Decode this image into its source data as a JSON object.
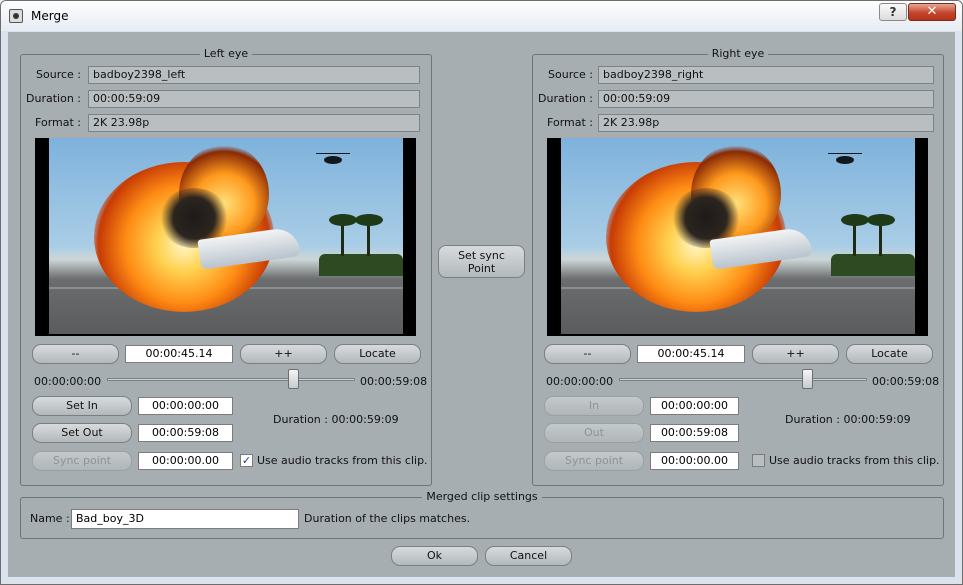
{
  "window": {
    "title": "Merge",
    "help_label": "?",
    "close_label": "✕",
    "icon": "merge-app-icon"
  },
  "left": {
    "title": "Left eye",
    "source_label": "Source :",
    "source": "badboy2398_left",
    "duration_label": "Duration :",
    "duration": "00:00:59:09",
    "format_label": "Format :",
    "format": "2K 23.98p",
    "nav": {
      "prev": "--",
      "timecode": "00:00:45.14",
      "next": "++",
      "locate": "Locate"
    },
    "range_start": "00:00:00:00",
    "range_end": "00:00:59:08",
    "slider_position": 0.76,
    "set_in_label": "Set In",
    "in_value": "00:00:00:00",
    "set_out_label": "Set Out",
    "out_value": "00:00:59:08",
    "sync_label": "Sync point",
    "sync_value": "00:00:00.00",
    "duration_text": "Duration : 00:00:59:09",
    "audio_label": "Use audio tracks from this clip.",
    "audio_checked": true
  },
  "right": {
    "title": "Right eye",
    "source_label": "Source :",
    "source": "badboy2398_right",
    "duration_label": "Duration :",
    "duration": "00:00:59:09",
    "format_label": "Format :",
    "format": "2K 23.98p",
    "nav": {
      "prev": "--",
      "timecode": "00:00:45.14",
      "next": "++",
      "locate": "Locate"
    },
    "range_start": "00:00:00:00",
    "range_end": "00:00:59:08",
    "slider_position": 0.76,
    "set_in_label": "In",
    "in_value": "00:00:00:00",
    "set_out_label": "Out",
    "out_value": "00:00:59:08",
    "sync_label": "Sync point",
    "sync_value": "00:00:00.00",
    "duration_text": "Duration : 00:00:59:09",
    "audio_label": "Use audio tracks from this clip.",
    "audio_checked": false
  },
  "set_sync_point": "Set sync\nPoint",
  "merged": {
    "title": "Merged clip settings",
    "name_label": "Name :",
    "name_value": "Bad_boy_3D",
    "status": "Duration of the clips matches."
  },
  "actions": {
    "ok": "Ok",
    "cancel": "Cancel"
  }
}
